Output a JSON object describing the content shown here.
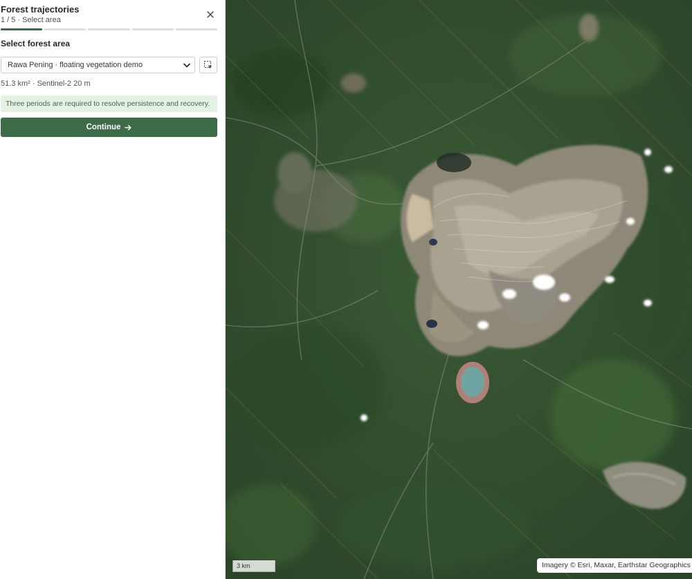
{
  "panel": {
    "title": "Forest trajectories",
    "step_text": "1 / 5 · Select area",
    "close_icon": "close-icon",
    "progress": {
      "current_step": 1,
      "total_steps": 5
    },
    "section_title": "Select forest area",
    "area_select": {
      "selected": "Rawa Pening · floating vegetation demo",
      "chevron_icon": "chevron-down-icon"
    },
    "draw_area_icon": "draw-selection-icon",
    "area_meta": "51.3 km² · Sentinel-2 20 m",
    "notice": "Three periods are required to resolve persistence and recovery.",
    "continue_label": "Continue",
    "continue_icon": "arrow-right-icon"
  },
  "map": {
    "scale_label": "3 km",
    "attribution": "Imagery © Esri, Maxar, Earthstar Geographics |"
  },
  "colors": {
    "accent": "#3d6b48",
    "progress_inactive": "#dcdfdc",
    "notice_bg": "#e6f1e5",
    "notice_text": "#3f6a46"
  }
}
